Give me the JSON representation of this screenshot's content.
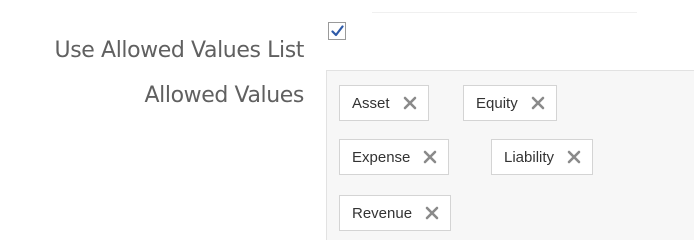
{
  "form": {
    "use_allowed_label": "Use Allowed Values List",
    "use_allowed_checked": true,
    "allowed_values_label": "Allowed Values"
  },
  "allowed_values": [
    "Asset",
    "Equity",
    "Expense",
    "Liability",
    "Revenue"
  ],
  "colors": {
    "check": "#2e5aa8",
    "remove_icon": "#8a8a8a",
    "box_bg": "#f7f7f7"
  }
}
